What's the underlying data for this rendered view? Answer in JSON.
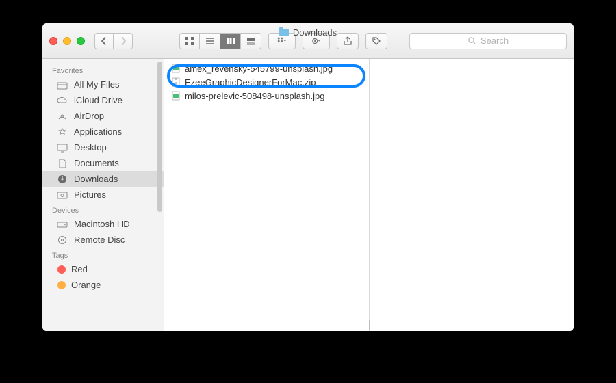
{
  "window": {
    "title": "Downloads"
  },
  "toolbar": {
    "search_placeholder": "Search"
  },
  "sidebar": {
    "sections": [
      {
        "label": "Favorites",
        "items": [
          {
            "label": "All My Files",
            "icon": "all-my-files"
          },
          {
            "label": "iCloud Drive",
            "icon": "icloud"
          },
          {
            "label": "AirDrop",
            "icon": "airdrop"
          },
          {
            "label": "Applications",
            "icon": "applications"
          },
          {
            "label": "Desktop",
            "icon": "desktop"
          },
          {
            "label": "Documents",
            "icon": "documents"
          },
          {
            "label": "Downloads",
            "icon": "downloads",
            "selected": true
          },
          {
            "label": "Pictures",
            "icon": "pictures"
          }
        ]
      },
      {
        "label": "Devices",
        "items": [
          {
            "label": "Macintosh HD",
            "icon": "hdd"
          },
          {
            "label": "Remote Disc",
            "icon": "disc"
          }
        ]
      },
      {
        "label": "Tags",
        "items": [
          {
            "label": "Red",
            "icon": "tag",
            "color": "#ff5e57"
          },
          {
            "label": "Orange",
            "icon": "tag",
            "color": "#ffae42"
          }
        ]
      }
    ]
  },
  "files": [
    {
      "name": "amex_revensky-545799-unsplash.jpg",
      "type": "jpg"
    },
    {
      "name": "EzeeGraphicDesignerForMac.zip",
      "type": "zip",
      "highlighted": true
    },
    {
      "name": "milos-prelevic-508498-unsplash.jpg",
      "type": "jpg"
    }
  ]
}
